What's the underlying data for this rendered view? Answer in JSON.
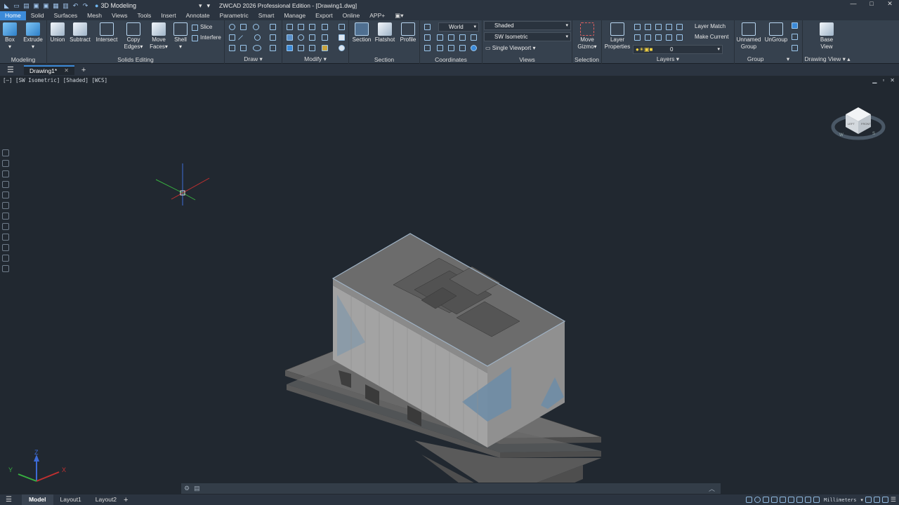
{
  "titlebar": {
    "workspace": "3D Modeling",
    "title": "ZWCAD 2026 Professional Edition - [Drawing1.dwg]",
    "minimize": "—",
    "maximize": "□",
    "close": "✕"
  },
  "menu": [
    "Home",
    "Solid",
    "Surfaces",
    "Mesh",
    "Views",
    "Tools",
    "Insert",
    "Annotate",
    "Parametric",
    "Smart",
    "Manage",
    "Export",
    "Online",
    "APP+"
  ],
  "ribbon": {
    "modeling": {
      "label": "Modeling",
      "box": "Box",
      "extrude": "Extrude"
    },
    "solids_editing": {
      "label": "Solids Editing",
      "union": "Union",
      "subtract": "Subtract",
      "intersect": "Intersect",
      "copy_edges_1": "Copy",
      "copy_edges_2": "Edges",
      "move_faces_1": "Move",
      "move_faces_2": "Faces",
      "shell": "Shell",
      "slice": "Slice",
      "interfere": "Interfere"
    },
    "draw": {
      "label": "Draw"
    },
    "modify": {
      "label": "Modify"
    },
    "section": {
      "label": "Section",
      "section": "Section",
      "flatshot": "Flatshot",
      "profile": "Profile"
    },
    "coordinates": {
      "label": "Coordinates",
      "ucs": "World"
    },
    "views": {
      "label": "Views",
      "visual_style": "Shaded",
      "view": "SW Isometric",
      "viewport": "Single Viewport"
    },
    "selection": {
      "label": "Selection",
      "gizmo_1": "Move",
      "gizmo_2": "Gizmo"
    },
    "layers": {
      "label": "Layers",
      "properties_1": "Layer",
      "properties_2": "Properties",
      "layer_match": "Layer Match",
      "make_current": "Make Current",
      "current_layer": "0"
    },
    "group": {
      "label": "Group",
      "unnamed_1": "Unnamed",
      "unnamed_2": "Group",
      "ungroup": "UnGroup"
    },
    "drawing_view": {
      "label": "Drawing View",
      "base_1": "Base",
      "base_2": "View"
    }
  },
  "tabs": {
    "document": "Drawing1*"
  },
  "viewport": {
    "label": "[—] [SW Isometric] [Shaded] [WCS]"
  },
  "status": {
    "model": "Model",
    "layout1": "Layout1",
    "layout2": "Layout2",
    "units": "Millimeters"
  },
  "colors": {
    "accent": "#3c8ad8",
    "background": "#212830",
    "ribbon": "#36414e"
  }
}
